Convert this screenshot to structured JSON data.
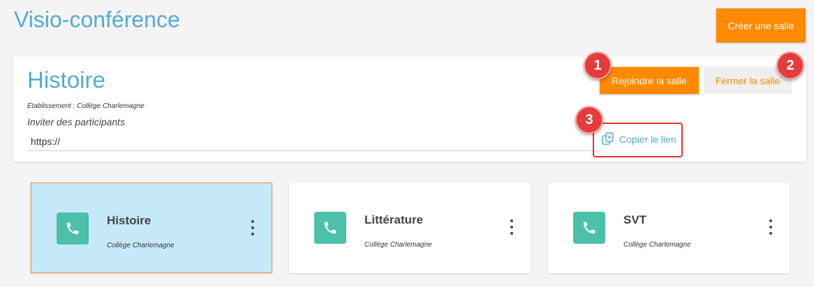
{
  "header": {
    "title": "Visio-conférence",
    "create_label": "Créer une salle"
  },
  "room": {
    "title": "Histoire",
    "school": "Établissement : Collège Charlemagne",
    "invite_label": "Inviter des participants",
    "invite_value": "https://",
    "join_label": "Rejoindre la salle",
    "close_label": "Fermer la salle",
    "copy_label": "Copier le lien"
  },
  "markers": [
    "1",
    "2",
    "3"
  ],
  "cards": [
    {
      "title": "Histoire",
      "school": "Collège Charlemagne",
      "active": true
    },
    {
      "title": "Littérature",
      "school": "Collège Charlemagne",
      "active": false
    },
    {
      "title": "SVT",
      "school": "Collège Charlemagne",
      "active": false
    }
  ],
  "colors": {
    "accent": "#ff8a00",
    "title_blue": "#55abd3",
    "icon_teal": "#4cc1a9",
    "active_card": "#c6e9f9",
    "marker_red": "#e63b3b"
  }
}
